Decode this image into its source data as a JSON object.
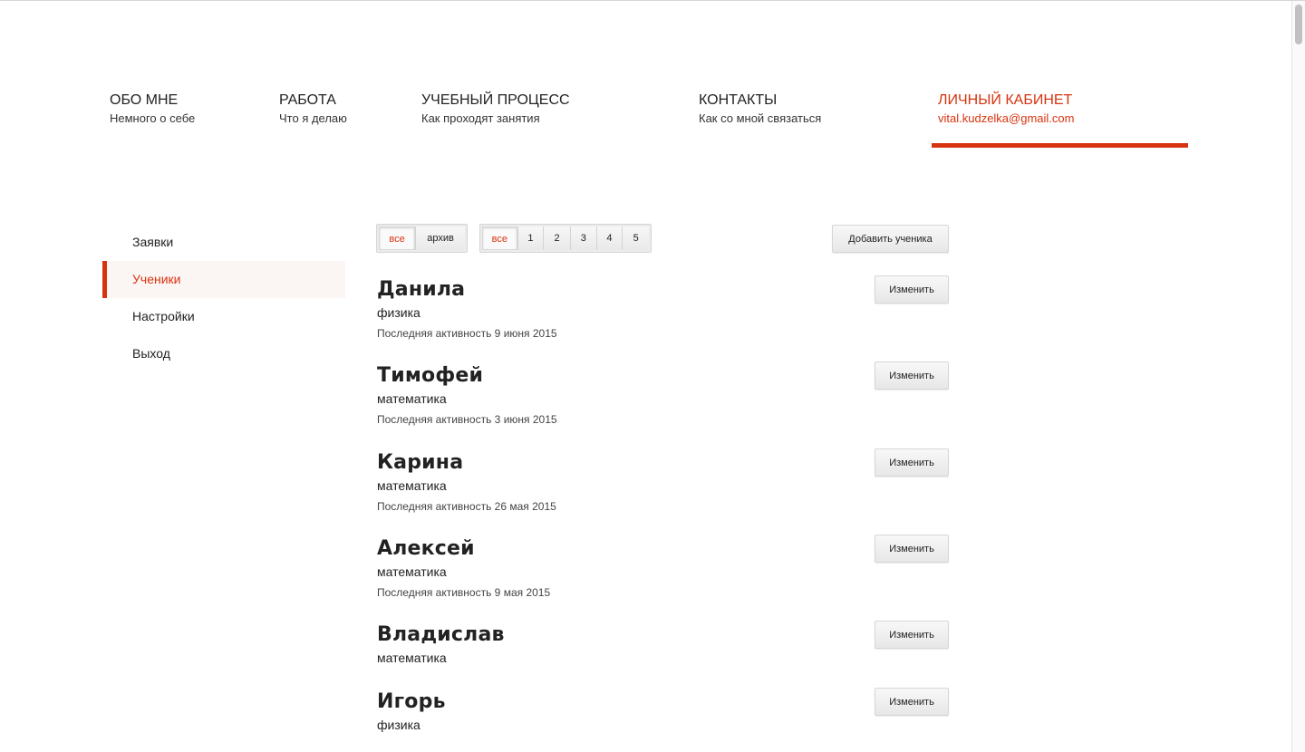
{
  "nav": [
    {
      "title": "ОБО МНЕ",
      "sub": "Немного о себе"
    },
    {
      "title": "РАБОТА",
      "sub": "Что я делаю"
    },
    {
      "title": "УЧЕБНЫЙ ПРОЦЕСС",
      "sub": "Как проходят занятия"
    },
    {
      "title": "КОНТАКТЫ",
      "sub": "Как со мной связаться"
    },
    {
      "title": "ЛИЧНЫЙ КАБИНЕТ",
      "sub": "vital.kudzelka@gmail.com"
    }
  ],
  "sidebar": {
    "items": [
      {
        "label": "Заявки"
      },
      {
        "label": "Ученики"
      },
      {
        "label": "Настройки"
      },
      {
        "label": "Выход"
      }
    ],
    "active_index": 1
  },
  "filters": {
    "status": [
      "все",
      "архив"
    ],
    "pages": [
      "все",
      "1",
      "2",
      "3",
      "4",
      "5"
    ]
  },
  "actions": {
    "add_student": "Добавить ученика",
    "edit": "Изменить"
  },
  "students": [
    {
      "name": "Данила",
      "subject": "физика",
      "activity": "Последняя активность 9 июня 2015"
    },
    {
      "name": "Тимофей",
      "subject": "математика",
      "activity": "Последняя активность 3 июня 2015"
    },
    {
      "name": "Карина",
      "subject": "математика",
      "activity": "Последняя активность 26 мая 2015"
    },
    {
      "name": "Алексей",
      "subject": "математика",
      "activity": "Последняя активность 9 мая 2015"
    },
    {
      "name": "Владислав",
      "subject": "математика",
      "activity": ""
    },
    {
      "name": "Игорь",
      "subject": "физика",
      "activity": ""
    }
  ],
  "colors": {
    "accent": "#d8330f"
  }
}
